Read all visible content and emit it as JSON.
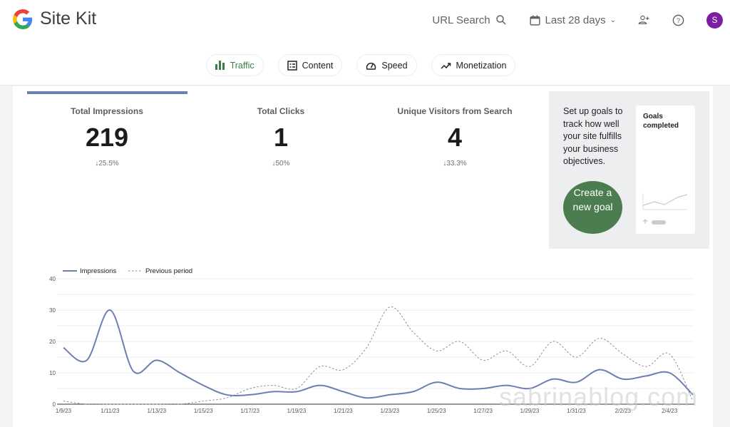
{
  "header": {
    "app_title": "Site Kit",
    "url_search": "URL Search",
    "date_range": "Last 28 days",
    "avatar_letter": "S"
  },
  "tabs": [
    {
      "label": "Traffic",
      "active": true
    },
    {
      "label": "Content"
    },
    {
      "label": "Speed"
    },
    {
      "label": "Monetization"
    }
  ],
  "metrics": [
    {
      "label": "Total Impressions",
      "value": "219",
      "change": "25.5%",
      "direction": "down"
    },
    {
      "label": "Total Clicks",
      "value": "1",
      "change": "50%",
      "direction": "down"
    },
    {
      "label": "Unique Visitors from Search",
      "value": "4",
      "change": "33.3%",
      "direction": "down"
    }
  ],
  "goals": {
    "text": "Set up goals to track how well your site fulfills your business objectives.",
    "button": "Create a new goal",
    "card_title": "Goals completed"
  },
  "colors": {
    "accent": "#6d7fb0",
    "goal_button": "#4c7d51",
    "down": "#c5422b",
    "avatar": "#7b1fa2"
  },
  "watermark": "sabrinablog.com",
  "chart_data": {
    "type": "line",
    "legend": [
      "Impressions",
      "Previous period"
    ],
    "legend_position": "top-left",
    "ylim": [
      0,
      40
    ],
    "yticks": [
      "0",
      "10",
      "20",
      "30",
      "40"
    ],
    "xticks": [
      "1/9/23",
      "1/11/23",
      "1/13/23",
      "1/15/23",
      "1/17/23",
      "1/19/23",
      "1/21/23",
      "1/23/23",
      "1/25/23",
      "1/27/23",
      "1/29/23",
      "1/31/23",
      "2/2/23",
      "2/4/23"
    ],
    "x": [
      "1/9",
      "1/10",
      "1/11",
      "1/12",
      "1/13",
      "1/14",
      "1/15",
      "1/16",
      "1/17",
      "1/18",
      "1/19",
      "1/20",
      "1/21",
      "1/22",
      "1/23",
      "1/24",
      "1/25",
      "1/26",
      "1/27",
      "1/28",
      "1/29",
      "1/30",
      "1/31",
      "2/1",
      "2/2",
      "2/3",
      "2/4",
      "2/5"
    ],
    "series": [
      {
        "name": "Impressions",
        "style": "solid",
        "color": "#6d7fb0",
        "values": [
          18,
          14,
          30,
          10.5,
          14,
          10,
          6,
          3,
          3,
          4,
          4,
          6,
          4,
          2,
          3,
          4,
          7,
          5,
          5,
          6,
          5,
          8,
          7,
          11,
          8,
          9,
          10,
          3
        ]
      },
      {
        "name": "Previous period",
        "style": "dashed",
        "color": "#8a8d91",
        "values": [
          1,
          0,
          0,
          0,
          0,
          0,
          1,
          2,
          5,
          6,
          5,
          12,
          11,
          18,
          31,
          23,
          17,
          20,
          14,
          17,
          12,
          20,
          15,
          21,
          16,
          12,
          16,
          1
        ]
      }
    ],
    "grid": true
  }
}
